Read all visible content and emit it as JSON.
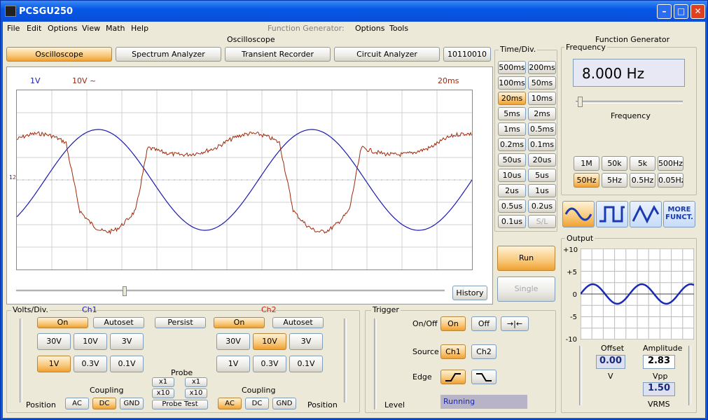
{
  "window": {
    "title": "PCSGU250"
  },
  "menu": {
    "file": "File",
    "edit": "Edit",
    "options": "Options",
    "view": "View",
    "math": "Math",
    "help": "Help",
    "fg_label": "Function Generator:",
    "fg_options": "Options",
    "fg_tools": "Tools"
  },
  "osc": {
    "group": "Oscilloscope",
    "tabs": {
      "oscilloscope": "Oscilloscope",
      "spectrum": "Spectrum Analyzer",
      "transient": "Transient Recorder",
      "circuit": "Circuit Analyzer",
      "bits": "10110010"
    },
    "screen": {
      "ch1_scale": "1V",
      "ch2_scale": "10V ~",
      "time_scale": "20ms",
      "ch1_marker": "1",
      "ch2_marker": "2",
      "history": "History"
    },
    "colors": {
      "ch1": "#1a1ab0",
      "ch2": "#a0280a",
      "grid": "#d0d0d0"
    }
  },
  "timediv": {
    "label": "Time/Div.",
    "buttons": [
      "500ms",
      "200ms",
      "100ms",
      "50ms",
      "20ms",
      "10ms",
      "5ms",
      "2ms",
      "1ms",
      "0.5ms",
      "0.2ms",
      "0.1ms",
      "50us",
      "20us",
      "10us",
      "5us",
      "2us",
      "1us",
      "0.5us",
      "0.2us",
      "0.1us",
      "S/L"
    ],
    "selected": "20ms"
  },
  "runctl": {
    "run": "Run",
    "single": "Single"
  },
  "volts": {
    "label": "Volts/Div.",
    "ch1": "Ch1",
    "ch2": "Ch2",
    "on": "On",
    "autoset": "Autoset",
    "persist": "Persist",
    "ch1_buttons": [
      "30V",
      "10V",
      "3V",
      "1V",
      "0.3V",
      "0.1V"
    ],
    "ch1_selected": "1V",
    "ch2_buttons": [
      "30V",
      "10V",
      "3V",
      "1V",
      "0.3V",
      "0.1V"
    ],
    "ch2_selected": "10V",
    "probe": "Probe",
    "x1": "x1",
    "x10": "x10",
    "probe_test": "Probe Test",
    "coupling": "Coupling",
    "ac": "AC",
    "dc": "DC",
    "gnd": "GND",
    "ch1_coupling": "DC",
    "ch2_coupling": "AC",
    "position": "Position"
  },
  "trigger": {
    "label": "Trigger",
    "onoff": "On/Off",
    "on": "On",
    "off": "Off",
    "source": "Source",
    "ch1": "Ch1",
    "ch2": "Ch2",
    "edge": "Edge",
    "level": "Level",
    "status": "Running"
  },
  "fg": {
    "group": "Function Generator",
    "freq_group": "Frequency",
    "freq_value": "8.000 Hz",
    "freq_slider_label": "Frequency",
    "freq_slider_pos": 0.02,
    "range_buttons": [
      "1M",
      "50k",
      "5k",
      "500Hz",
      "50Hz",
      "5Hz",
      "0.5Hz",
      "0.05Hz"
    ],
    "range_selected": "50Hz",
    "more": "MORE FUNCT.",
    "wave_selected": "sine",
    "output": {
      "label": "Output",
      "yticks": [
        "+10",
        "+5",
        "0",
        "-5",
        "-10"
      ],
      "offset_label": "Offset",
      "offset_value": "0.00",
      "offset_unit": "V",
      "amp_label": "Amplitude",
      "amp_value": "2.83",
      "amp_unit": "Vpp",
      "rms_value": "1.50",
      "rms_unit": "VRMS"
    }
  }
}
